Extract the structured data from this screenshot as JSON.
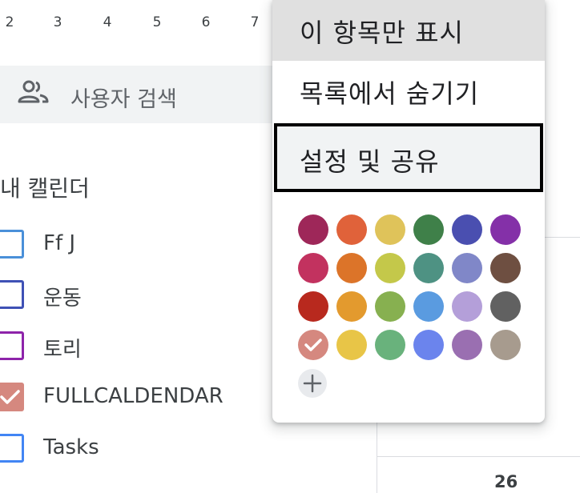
{
  "mini_calendar": {
    "days": [
      "2",
      "3",
      "4",
      "5",
      "6",
      "7"
    ]
  },
  "search": {
    "label": "사용자 검색",
    "icon": "people-icon"
  },
  "my_calendars": {
    "title": "내 캘린더",
    "items": [
      {
        "label": "Ff J",
        "checked": false,
        "color": "#4a90d9"
      },
      {
        "label": "운동",
        "checked": false,
        "color": "#3f51b5"
      },
      {
        "label": "토리",
        "checked": false,
        "color": "#8e24aa"
      },
      {
        "label": "FULLCALDENDAR",
        "checked": true,
        "color": "#d5887f"
      },
      {
        "label": "Tasks",
        "checked": false,
        "color": "#4285f4"
      }
    ]
  },
  "context_menu": {
    "items": [
      {
        "label": "이 항목만 표시",
        "state": "hover"
      },
      {
        "label": "목록에서 숨기기",
        "state": "normal"
      },
      {
        "label": "설정 및 공유",
        "state": "focused"
      }
    ],
    "colors": [
      [
        "#9e2759",
        "#e0623a",
        "#dfc35a",
        "#3f8049",
        "#4a4fb0",
        "#8430a8"
      ],
      [
        "#c2325f",
        "#dc7429",
        "#c4c84a",
        "#4e9283",
        "#8087c8",
        "#6e4f41"
      ],
      [
        "#b8291e",
        "#e39a2e",
        "#87b050",
        "#5a9be0",
        "#b49fd9",
        "#616161"
      ],
      [
        "#d5887f",
        "#e8c547",
        "#69b27c",
        "#6b84ed",
        "#9a6fb1",
        "#a79b8e"
      ]
    ],
    "selected_color": "#d5887f",
    "add_color_icon": "plus-icon"
  },
  "calendar_grid": {
    "visible_date": "26"
  }
}
